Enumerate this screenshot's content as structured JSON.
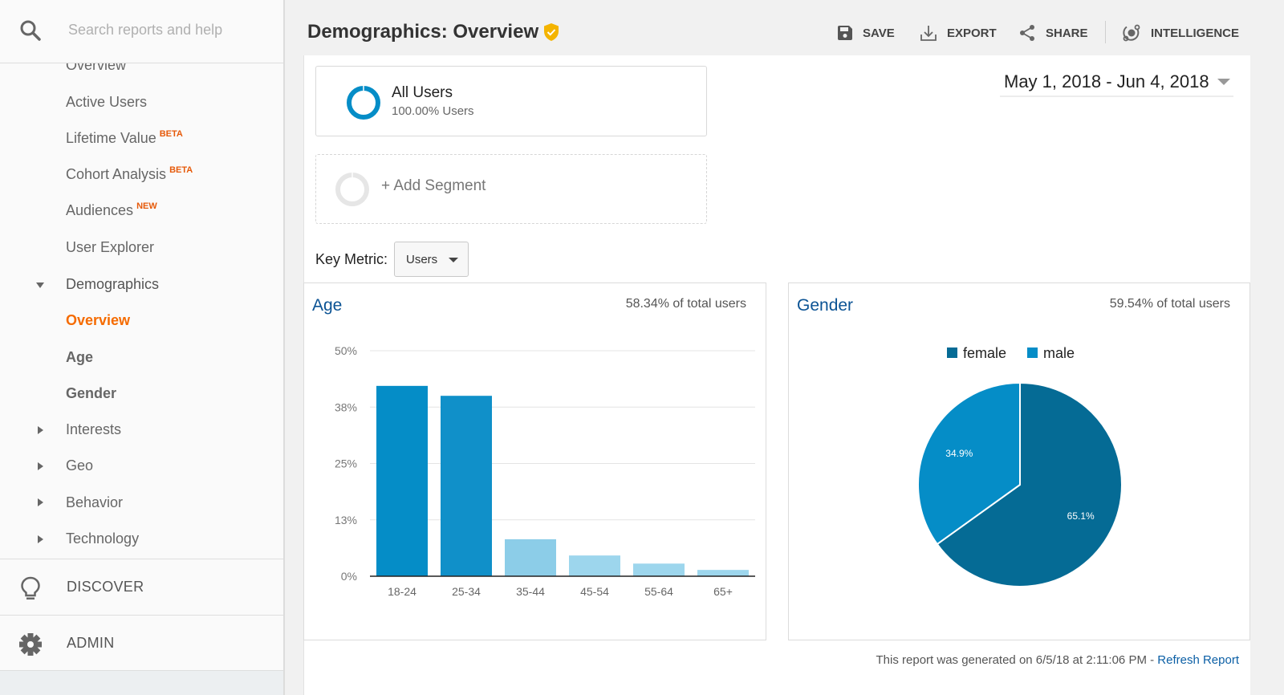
{
  "search": {
    "placeholder": "Search reports and help"
  },
  "sidebar": {
    "items": [
      {
        "label": "Overview",
        "badge": ""
      },
      {
        "label": "Active Users",
        "badge": ""
      },
      {
        "label": "Lifetime Value",
        "badge": "BETA"
      },
      {
        "label": "Cohort Analysis",
        "badge": "BETA"
      },
      {
        "label": "Audiences",
        "badge": "NEW"
      },
      {
        "label": "User Explorer",
        "badge": ""
      }
    ],
    "demographics": {
      "label": "Demographics",
      "expanded": true,
      "children": [
        {
          "label": "Overview",
          "active": true
        },
        {
          "label": "Age",
          "active": false
        },
        {
          "label": "Gender",
          "active": false
        }
      ]
    },
    "collapsed_groups": [
      {
        "label": "Interests"
      },
      {
        "label": "Geo"
      },
      {
        "label": "Behavior"
      },
      {
        "label": "Technology"
      }
    ],
    "discover_label": "DISCOVER",
    "admin_label": "ADMIN"
  },
  "header": {
    "title": "Demographics: Overview",
    "verified_icon": "shield-check-icon",
    "toolbar": {
      "save": "SAVE",
      "export": "EXPORT",
      "share": "SHARE",
      "intelligence": "INTELLIGENCE"
    }
  },
  "segments": {
    "active": {
      "name": "All Users",
      "subtitle": "100.00% Users"
    },
    "add_label": "+ Add Segment"
  },
  "date_range": "May 1, 2018 - Jun 4, 2018",
  "key_metric": {
    "label": "Key Metric:",
    "value": "Users"
  },
  "colors": {
    "accent_orange": "#f56b00",
    "link_blue": "#0b5394",
    "bar_dark": "#058dc7",
    "bar_light": "#92d0ea",
    "female": "#056b95",
    "male": "#058dc7"
  },
  "chart_data": [
    {
      "type": "bar",
      "title": "Age",
      "subtitle": "58.34% of total users",
      "categories": [
        "18-24",
        "25-34",
        "35-44",
        "45-54",
        "55-64",
        "65+"
      ],
      "values": [
        42.2,
        40.0,
        8.2,
        4.6,
        2.8,
        1.4
      ],
      "yticks": [
        "0%",
        "13%",
        "25%",
        "38%",
        "50%"
      ],
      "ytick_values": [
        0,
        12.5,
        25,
        37.5,
        50
      ],
      "ylim": [
        0,
        50
      ],
      "xlabel": "",
      "ylabel": "",
      "grid": true,
      "units": "percent of users"
    },
    {
      "type": "pie",
      "title": "Gender",
      "subtitle": "59.54% of total users",
      "labels": [
        "female",
        "male"
      ],
      "values": [
        65.1,
        34.9
      ],
      "data_labels": [
        "65.1%",
        "34.9%"
      ],
      "legend": "top"
    }
  ],
  "footer": {
    "text": "This report was generated on 6/5/18 at 2:11:06 PM - ",
    "link": "Refresh Report"
  }
}
